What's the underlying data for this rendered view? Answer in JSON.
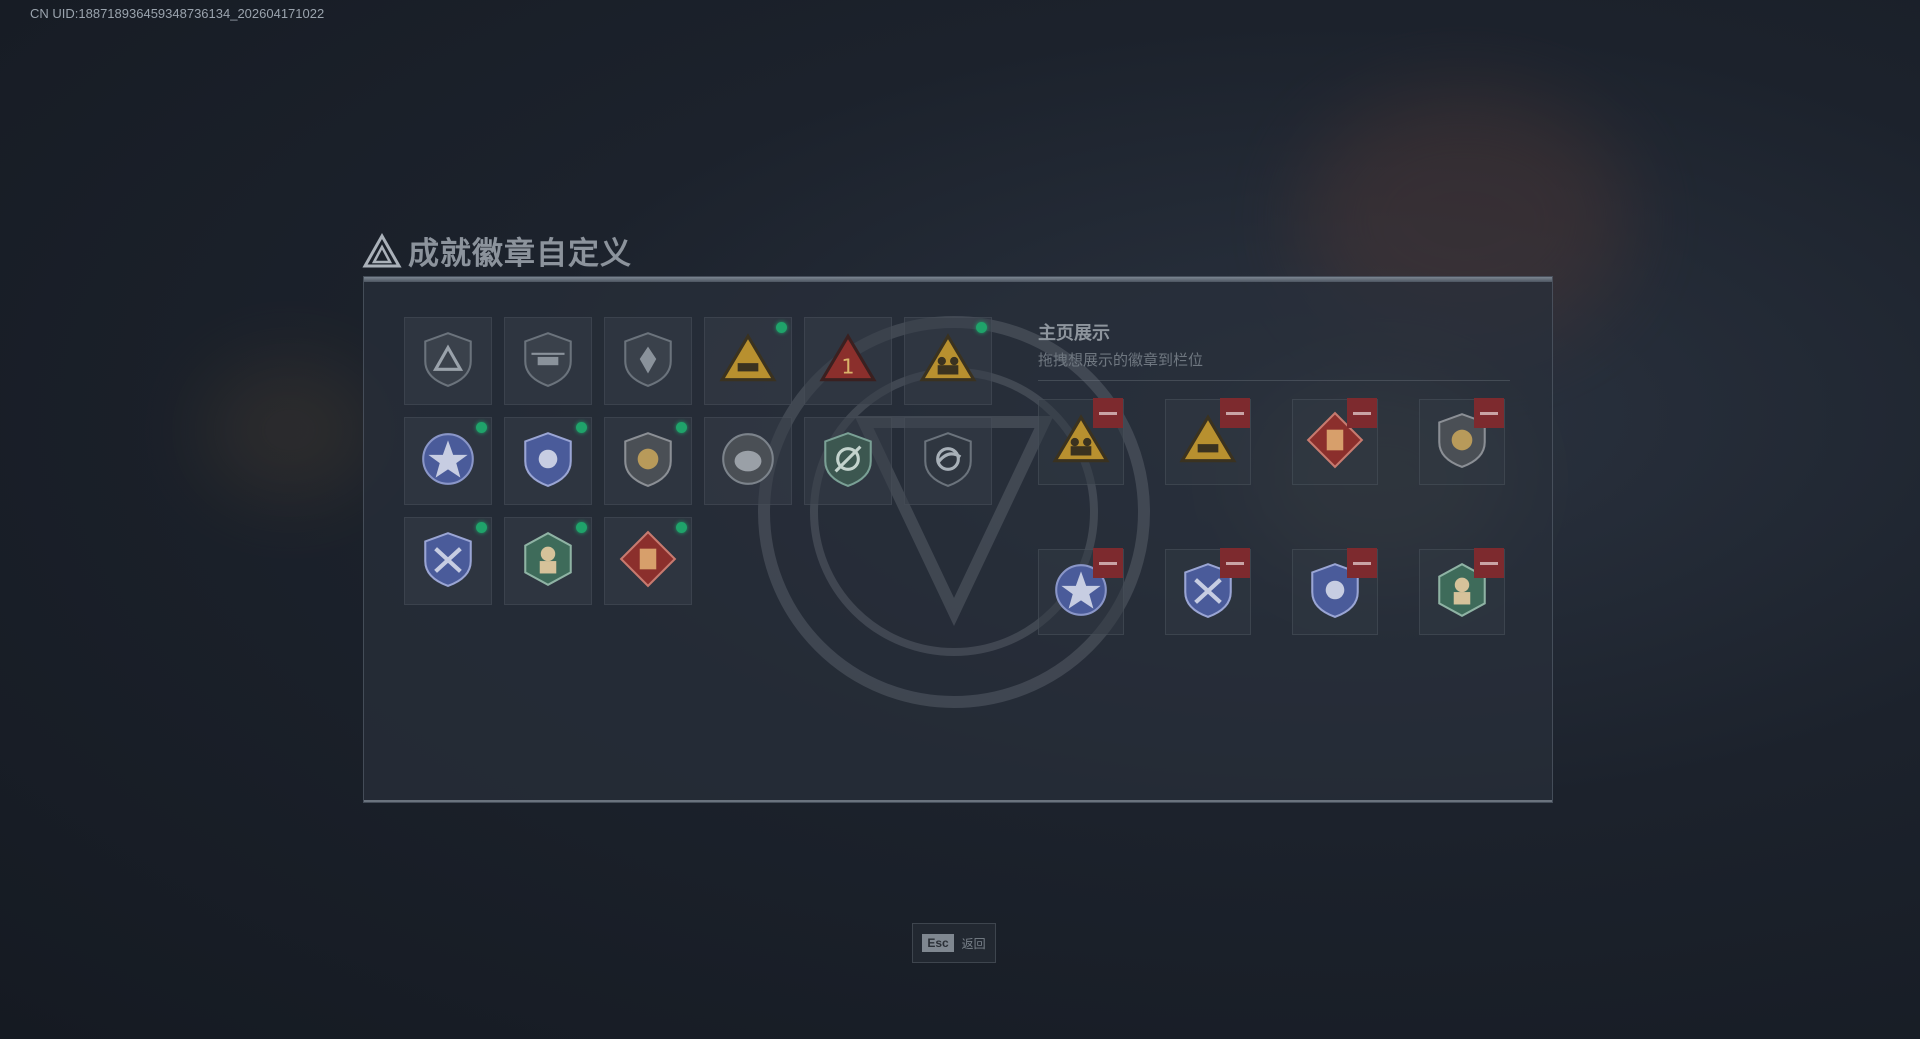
{
  "uid_text": "CN UID:188718936459348736134_202604171022",
  "page_title": "成就徽章自定义",
  "showcase": {
    "title": "主页展示",
    "subtitle": "拖拽想展示的徽章到栏位"
  },
  "badges": [
    {
      "icon": "triangle-shield-badge-icon",
      "new": false
    },
    {
      "icon": "helicopter-badge-icon",
      "new": false
    },
    {
      "icon": "winged-shield-badge-icon",
      "new": false
    },
    {
      "icon": "gold-triangle-tank-badge-icon",
      "new": true
    },
    {
      "icon": "red-triangle-number-one-badge-icon",
      "new": false
    },
    {
      "icon": "gold-triangle-soldiers-badge-icon",
      "new": true
    },
    {
      "icon": "blue-star-badge-icon",
      "new": true
    },
    {
      "icon": "police-emblem-badge-icon",
      "new": true
    },
    {
      "icon": "lion-shield-badge-icon",
      "new": true
    },
    {
      "icon": "round-creature-badge-icon",
      "new": false
    },
    {
      "icon": "crosshair-shield-badge-icon",
      "new": false
    },
    {
      "icon": "dark-eagle-shield-badge-icon",
      "new": false
    },
    {
      "icon": "blue-crossed-weapons-badge-icon",
      "new": true
    },
    {
      "icon": "green-hexagon-soldier-badge-icon",
      "new": true
    },
    {
      "icon": "red-diamond-vest-badge-icon",
      "new": true
    }
  ],
  "showcase_slots": [
    {
      "icon": "gold-triangle-soldiers-badge-icon"
    },
    {
      "icon": "gold-triangle-tank-badge-icon"
    },
    {
      "icon": "red-diamond-vest-badge-icon"
    },
    {
      "icon": "lion-shield-badge-icon"
    },
    {
      "icon": "blue-star-badge-icon"
    },
    {
      "icon": "blue-crossed-weapons-badge-icon"
    },
    {
      "icon": "police-emblem-badge-icon"
    },
    {
      "icon": "green-hexagon-soldier-badge-icon"
    }
  ],
  "esc": {
    "key": "Esc",
    "label": "返回"
  },
  "colors": {
    "new_dot": "#1fa36a",
    "remove": "#7d2a2e",
    "gold": "#b8902f",
    "red": "#8b2f2c",
    "blue": "#4a5b9a",
    "green": "#3e6b5a"
  }
}
